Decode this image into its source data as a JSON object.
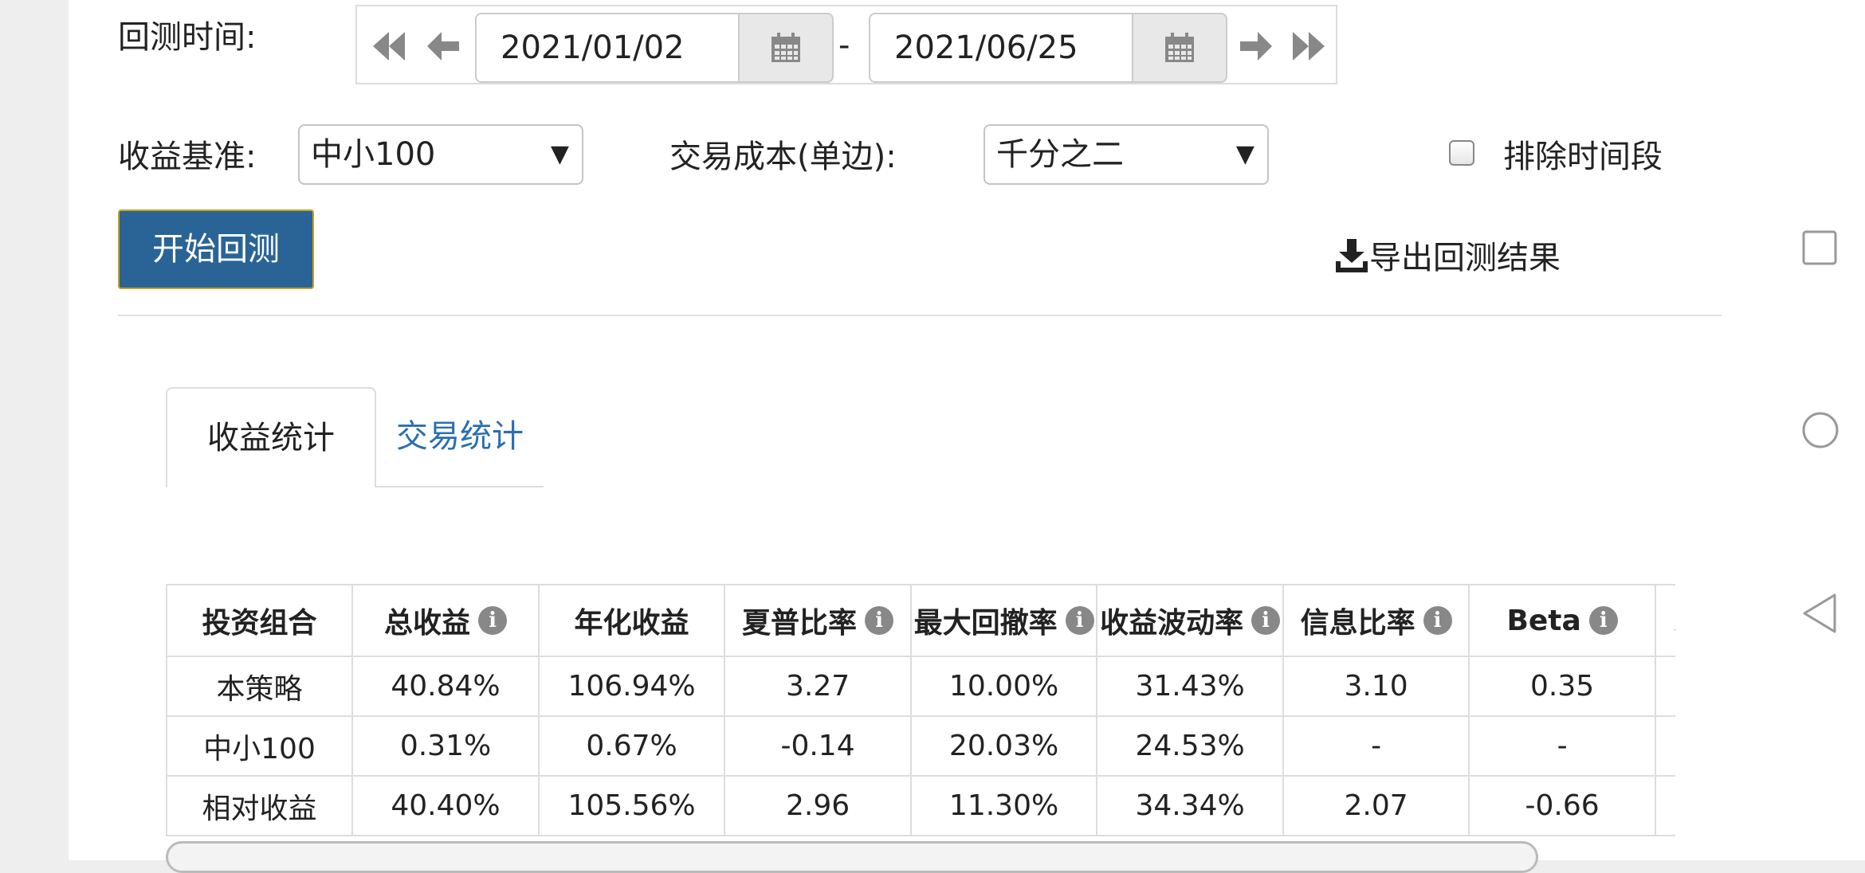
{
  "backtest": {
    "date_label": "回测时间:",
    "start_date": "2021/01/02",
    "end_date": "2021/06/25",
    "date_separator": "-"
  },
  "benchmark": {
    "label": "收益基准:",
    "selected": "中小100"
  },
  "cost": {
    "label": "交易成本(单边):",
    "selected": "千分之二"
  },
  "exclude": {
    "label": "排除时间段",
    "checked": false
  },
  "actions": {
    "start_label": "开始回测",
    "export_label": "导出回测结果"
  },
  "tabs": [
    {
      "label": "收益统计",
      "active": true
    },
    {
      "label": "交易统计",
      "active": false
    }
  ],
  "table": {
    "headers": [
      {
        "label": "投资组合",
        "info": false
      },
      {
        "label": "总收益",
        "info": true
      },
      {
        "label": "年化收益",
        "info": false
      },
      {
        "label": "夏普比率",
        "info": true
      },
      {
        "label": "最大回撤率",
        "info": true
      },
      {
        "label": "收益波动率",
        "info": true
      },
      {
        "label": "信息比率",
        "info": true
      },
      {
        "label": "Beta",
        "info": true
      },
      {
        "label": "Alpha",
        "info": true
      }
    ],
    "rows": [
      [
        "本策略",
        "40.84%",
        "106.94%",
        "3.27",
        "10.00%",
        "31.43%",
        "3.10",
        "0.35",
        ""
      ],
      [
        "中小100",
        "0.31%",
        "0.67%",
        "-0.14",
        "20.03%",
        "24.53%",
        "-",
        "-",
        ""
      ],
      [
        "相对收益",
        "40.40%",
        "105.56%",
        "2.96",
        "11.30%",
        "34.34%",
        "2.07",
        "-0.66",
        ""
      ]
    ]
  },
  "icons": {
    "first": "double-left-arrow-icon",
    "prev": "left-arrow-icon",
    "calendar": "calendar-icon",
    "next": "right-arrow-icon",
    "last": "double-right-arrow-icon",
    "download": "download-icon",
    "info": "info-icon"
  },
  "colors": {
    "primary": "#2a6496",
    "tab_link": "#2a6fb0",
    "info_icon": "#888888"
  }
}
